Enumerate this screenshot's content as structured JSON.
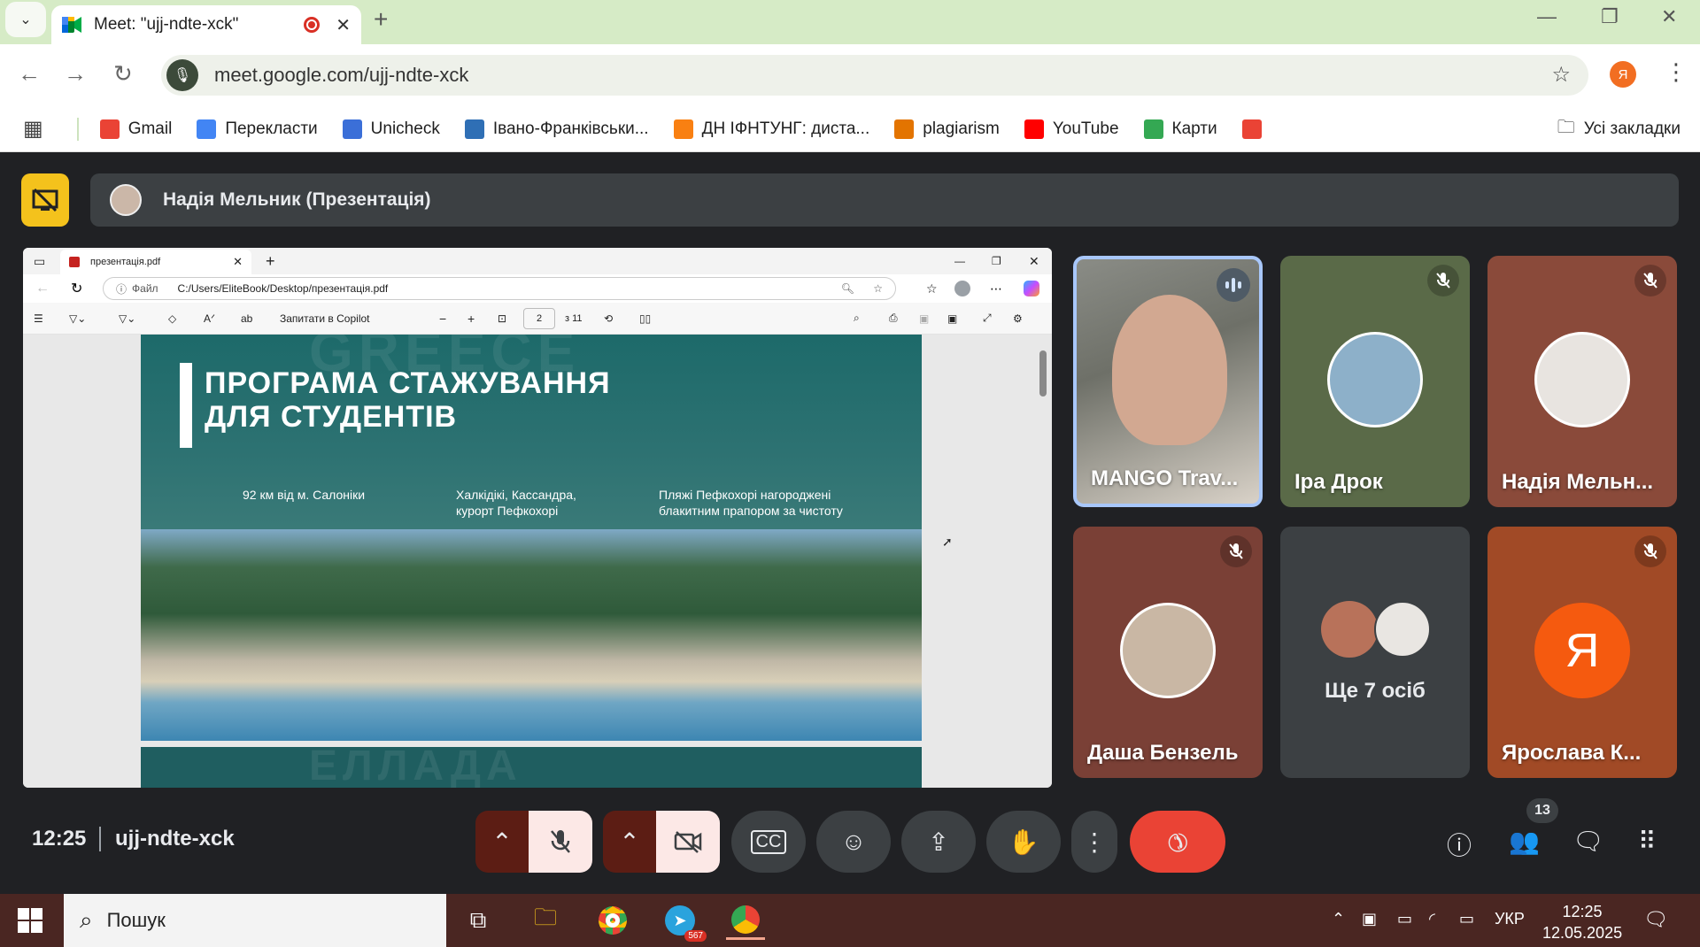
{
  "browser": {
    "tab_title": "Meet: \"ujj-ndte-xck\"",
    "url": "meet.google.com/ujj-ndte-xck",
    "profile_letter": "Я"
  },
  "bookmarks": [
    {
      "label": "Gmail",
      "icon": "gmail-icon",
      "color": "#ea4335"
    },
    {
      "label": "Перекласти",
      "icon": "translate-icon",
      "color": "#4285f4"
    },
    {
      "label": "Unicheck",
      "icon": "unicheck-icon",
      "color": "#3b6fd8"
    },
    {
      "label": "Івано-Франківськи...",
      "icon": "site-icon",
      "color": "#2f6fb5"
    },
    {
      "label": "ДН ІФНТУНГ: диста...",
      "icon": "moodle-icon",
      "color": "#f98012"
    },
    {
      "label": "plagiarism",
      "icon": "doc-icon",
      "color": "#e37400"
    },
    {
      "label": "YouTube",
      "icon": "youtube-icon",
      "color": "#ff0000"
    },
    {
      "label": "Карти",
      "icon": "maps-icon",
      "color": "#34a853"
    },
    {
      "label": "",
      "icon": "gmail-icon",
      "color": "#ea4335"
    }
  ],
  "all_bookmarks": "Усі закладки",
  "meet": {
    "presenter_label": "Надія Мельник (Презентація)",
    "code": "ujj-ndte-xck",
    "time": "12:25",
    "participants_count": "13",
    "accent_red": "#ea4335",
    "present_yellow": "#f4c21c"
  },
  "shared": {
    "tab_title": "презентація.pdf",
    "file_label": "Файл",
    "path": "C:/Users/EliteBook/Desktop/презентація.pdf",
    "copilot": "Запитати в Copilot",
    "page": "2",
    "page_total": "з 11",
    "slide": {
      "ghost": "GREECE",
      "headline_1": "ПРОГРАМА СТАЖУВАННЯ",
      "headline_2": "ДЛЯ СТУДЕНТІВ",
      "info_1": "92 км від м. Салоніки",
      "info_2": "Халкідікі, Кассандра, курорт Пефкохорі",
      "info_3": "Пляжі Пефкохорі нагороджені блакитним прапором за чистоту",
      "ghost_2": "ЕЛЛАДА"
    }
  },
  "participants": [
    {
      "name": "MANGO Trav...",
      "speaking": true
    },
    {
      "name": "Іра Дрок",
      "muted": true
    },
    {
      "name": "Надія Мельн...",
      "muted": true
    },
    {
      "name": "Даша Бензель",
      "muted": true
    },
    {
      "name": "Ще 7 осіб"
    },
    {
      "name": "Ярослава К...",
      "muted": true,
      "initial": "Я"
    }
  ],
  "taskbar": {
    "search_placeholder": "Пошук",
    "telegram_badge": "567",
    "lang": "УКР",
    "time": "12:25",
    "date": "12.05.2025"
  }
}
